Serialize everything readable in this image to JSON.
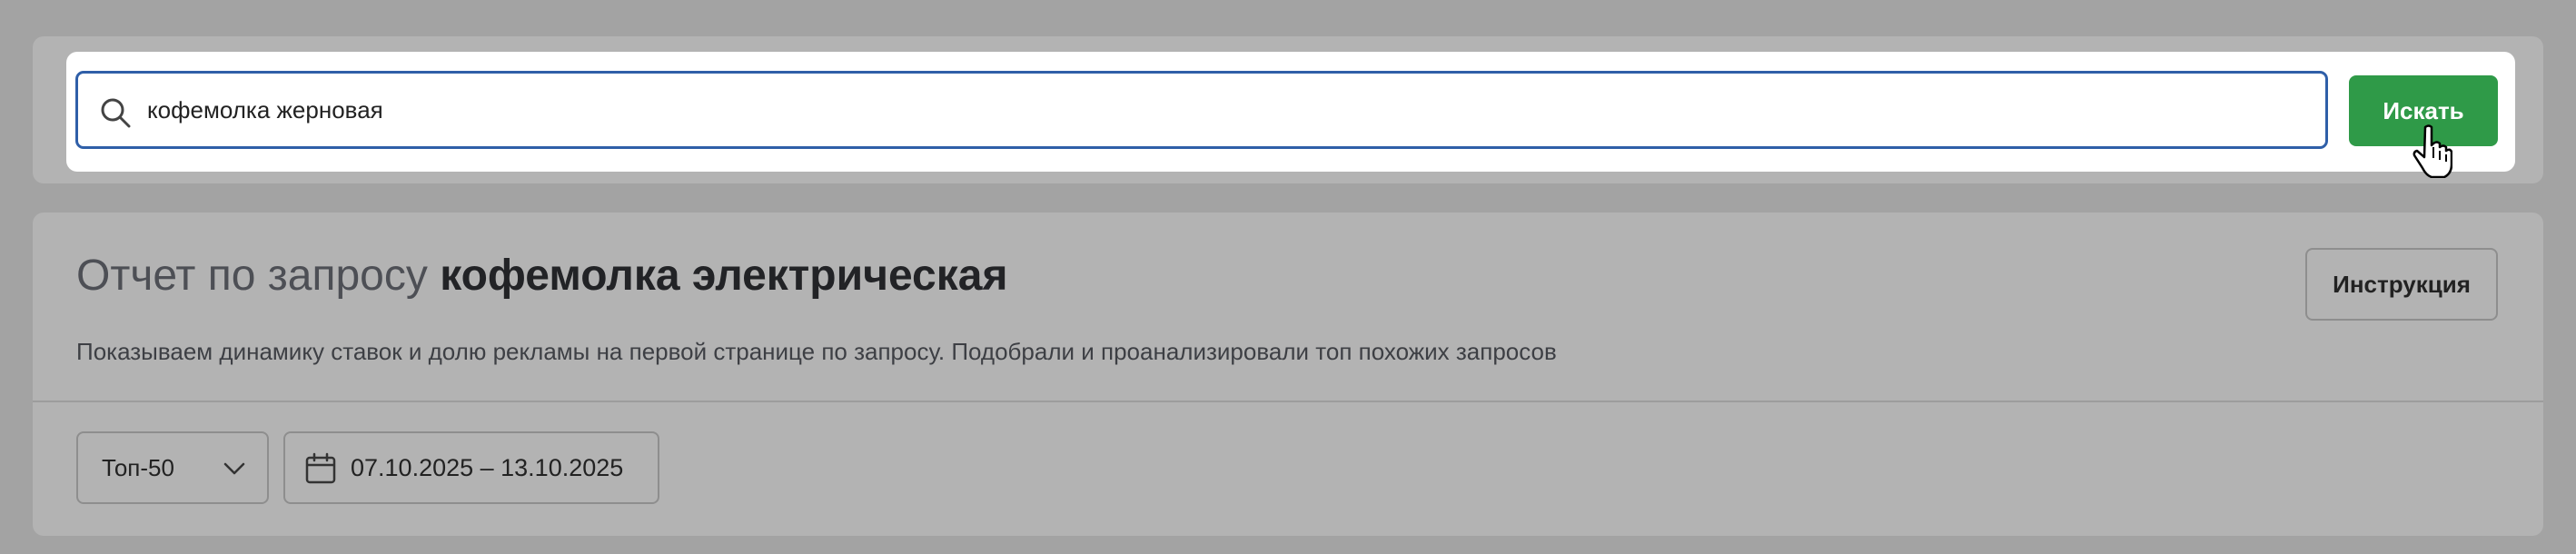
{
  "search": {
    "value": "кофемолка жерновая",
    "button_label": "Искать",
    "icon": "search-icon"
  },
  "report": {
    "title_prefix": "Отчет по запросу",
    "title_query": "кофемолка электрическая",
    "description": "Показываем динамику ставок и долю рекламы на первой странице по запросу. Подобрали и проанализировали топ похожих запросов",
    "instruction_button": "Инструкция"
  },
  "filters": {
    "top_select": "Топ-50",
    "date_range": "07.10.2025 – 13.10.2025"
  },
  "colors": {
    "accent_green": "#2f9a48",
    "focus_border": "#2f5fa8",
    "overlay_gray": "#a3a3a3"
  }
}
